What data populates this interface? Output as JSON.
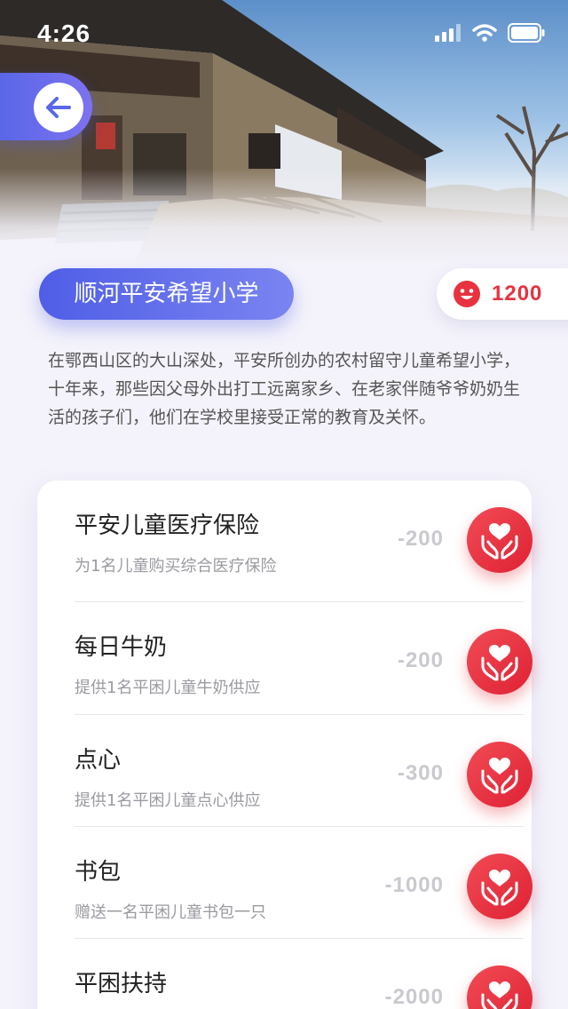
{
  "status_bar": {
    "time": "4:26"
  },
  "back_button": {
    "icon": "arrow-left-icon"
  },
  "school": {
    "name": "顺河平安希望小学"
  },
  "points": {
    "icon": "smiley-face-icon",
    "value": "1200",
    "color": "#e8323f"
  },
  "description": "在鄂西山区的大山深处，平安所创办的农村留守儿童希望小学，十年来，那些因父母外出打工远离家乡、在老家伴随爷爷奶奶生活的孩子们，他们在学校里接受正常的教育及关怀。",
  "items": [
    {
      "title": "平安儿童医疗保险",
      "subtitle": "为1名儿童购买综合医疗保险",
      "cost": "-200",
      "icon": "heart-hands-icon"
    },
    {
      "title": "每日牛奶",
      "subtitle": "提供1名平困儿童牛奶供应",
      "cost": "-200",
      "icon": "heart-hands-icon"
    },
    {
      "title": "点心",
      "subtitle": "提供1名平困儿童点心供应",
      "cost": "-300",
      "icon": "heart-hands-icon"
    },
    {
      "title": "书包",
      "subtitle": "赠送一名平困儿童书包一只",
      "cost": "-1000",
      "icon": "heart-hands-icon"
    },
    {
      "title": "平困扶持",
      "subtitle": "",
      "cost": "-2000",
      "icon": "heart-hands-icon"
    }
  ],
  "colors": {
    "accent": "#5967e8",
    "danger": "#e8323f",
    "background": "#f4f3fb"
  }
}
